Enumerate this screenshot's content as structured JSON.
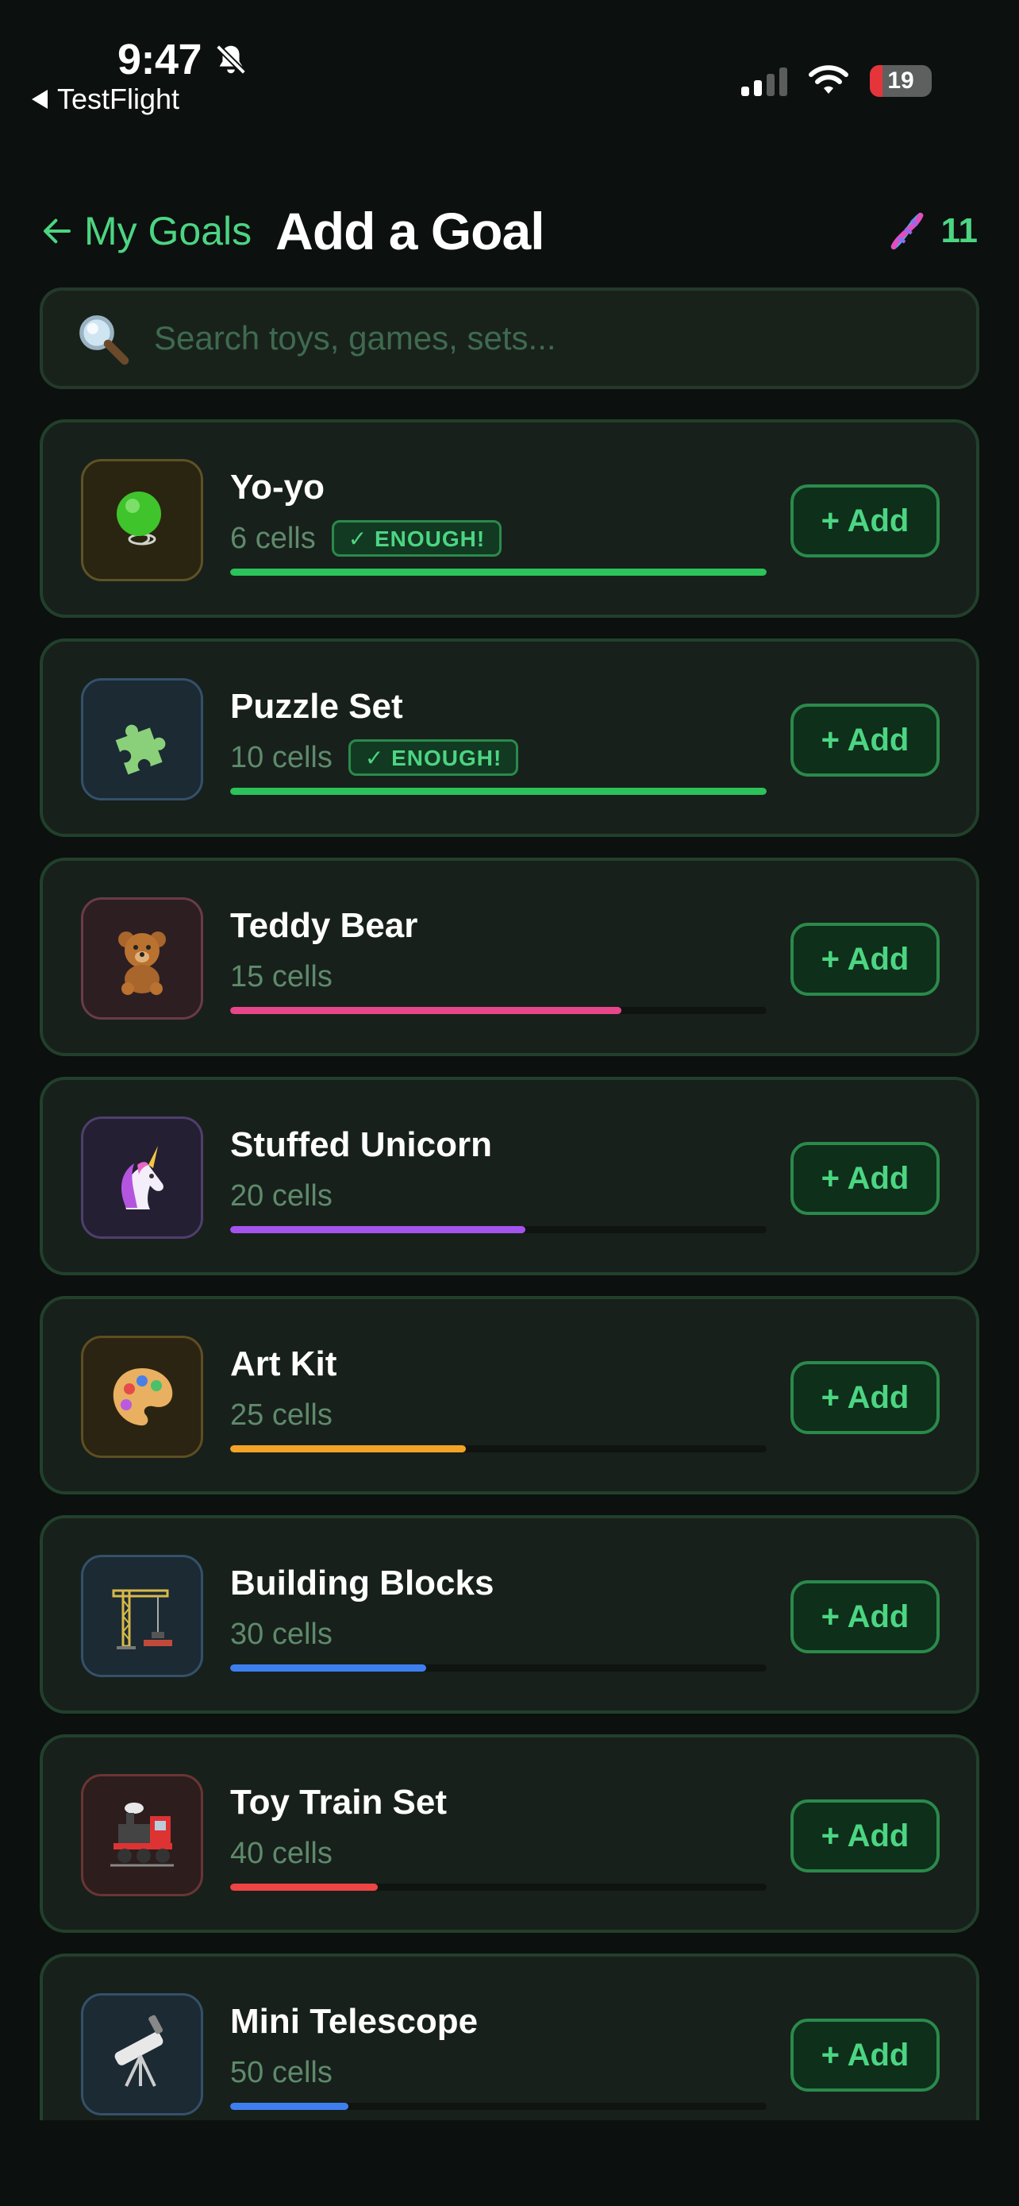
{
  "status_bar": {
    "time": "9:47",
    "back_app": "TestFlight",
    "battery": "19"
  },
  "header": {
    "back_label": "My Goals",
    "title": "Add a Goal",
    "dna_count": "11"
  },
  "search": {
    "placeholder": "Search toys, games, sets..."
  },
  "colors": {
    "accent": "#4cd582",
    "card_border": "#21402c",
    "background": "#0c100e"
  },
  "add_label": "+ Add",
  "enough_label": "✓ ENOUGH!",
  "goals": [
    {
      "name": "Yo-yo",
      "cells": "6 cells",
      "enough": true,
      "progress": 1.0,
      "color": "#2bc35a",
      "icon": "yoyo-icon"
    },
    {
      "name": "Puzzle Set",
      "cells": "10 cells",
      "enough": true,
      "progress": 1.0,
      "color": "#2bc35a",
      "icon": "puzzle-icon"
    },
    {
      "name": "Teddy Bear",
      "cells": "15 cells",
      "enough": false,
      "progress": 0.73,
      "color": "#e7468a",
      "icon": "teddy-bear-icon"
    },
    {
      "name": "Stuffed Unicorn",
      "cells": "20 cells",
      "enough": false,
      "progress": 0.55,
      "color": "#a553ef",
      "icon": "unicorn-icon"
    },
    {
      "name": "Art Kit",
      "cells": "25 cells",
      "enough": false,
      "progress": 0.44,
      "color": "#f2a325",
      "icon": "palette-icon"
    },
    {
      "name": "Building Blocks",
      "cells": "30 cells",
      "enough": false,
      "progress": 0.365,
      "color": "#3e7ff0",
      "icon": "crane-icon"
    },
    {
      "name": "Toy Train Set",
      "cells": "40 cells",
      "enough": false,
      "progress": 0.275,
      "color": "#ee4444",
      "icon": "train-icon"
    },
    {
      "name": "Mini Telescope",
      "cells": "50 cells",
      "enough": false,
      "progress": 0.22,
      "color": "#3e7ff0",
      "icon": "telescope-icon"
    }
  ]
}
